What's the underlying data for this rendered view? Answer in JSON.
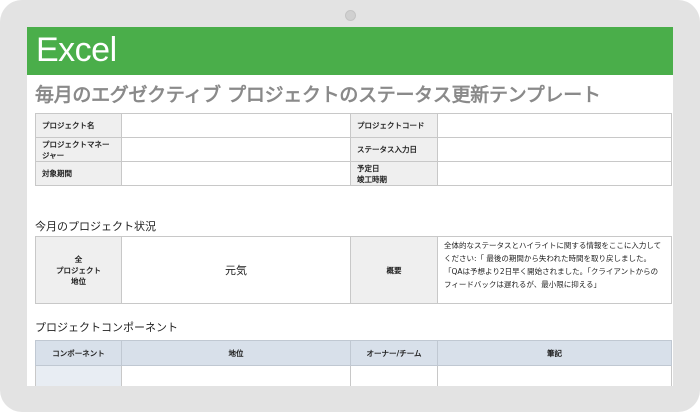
{
  "banner": {
    "title": "Excel"
  },
  "document": {
    "title": "毎月のエグゼクティブ プロジェクトのステータス更新テンプレート"
  },
  "info": {
    "project_name_label": "プロジェクト名",
    "project_code_label": "プロジェクトコード",
    "project_manager_label": "プロジェクトマネージャー",
    "status_entry_date_label": "ステータス入力日",
    "period_label": "対象期間",
    "planned_completion_label_1": "予定日",
    "planned_completion_label_2": "竣工時期",
    "project_name_value": "",
    "project_code_value": "",
    "project_manager_value": "",
    "status_entry_date_value": "",
    "period_value": "",
    "planned_completion_value": ""
  },
  "status_section": {
    "heading": "今月のプロジェクト状況",
    "overall_label_line1": "全",
    "overall_label_line2": "プロジェクト",
    "overall_label_line3": "地位",
    "overall_value": "元気",
    "summary_label": "概要",
    "summary_text": "全体的なステータスとハイライトに関する情報をここに入力してください:「 最後の期間から失われた時間を取り戻しました。「QAは予想より2日早く開始されました。「クライアントからのフィードバックは遅れるが、最小限に抑える」"
  },
  "components_section": {
    "heading": "プロジェクトコンポーネント",
    "columns": {
      "component": "コンポーネント",
      "status": "地位",
      "owner_team": "オーナー/チーム",
      "notes": "筆記"
    }
  }
}
